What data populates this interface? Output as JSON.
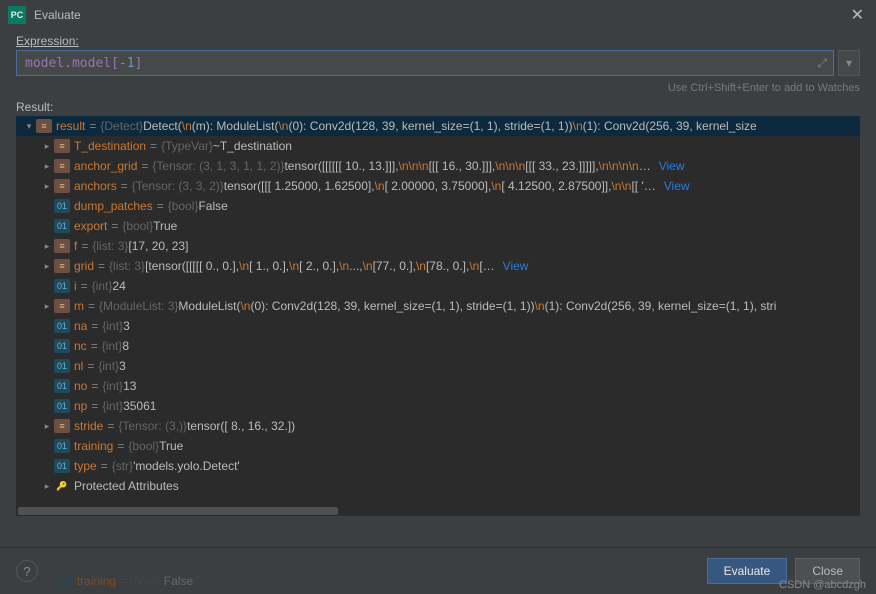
{
  "window": {
    "title": "Evaluate"
  },
  "labels": {
    "expression": "Expression:",
    "result": "Result:",
    "hint": "Use Ctrl+Shift+Enter to add to Watches"
  },
  "expression": {
    "prefix": "model.model[",
    "index": "-1",
    "suffix": "]"
  },
  "buttons": {
    "evaluate": "Evaluate",
    "close": "Close"
  },
  "tree": [
    {
      "depth": 0,
      "arrow": "down",
      "icon": "obj",
      "name": "result",
      "type": "{Detect}",
      "value_parts": [
        " Detect(",
        "\\n",
        "   (m): ModuleList(",
        "\\n",
        "     (0): Conv2d(128, 39, kernel_size=(1, 1), stride=(1, 1))",
        "\\n",
        "     (1): Conv2d(256, 39, kernel_size"
      ],
      "selected": true
    },
    {
      "depth": 1,
      "arrow": "right",
      "icon": "obj",
      "name": "T_destination",
      "type": "{TypeVar}",
      "value": " ~T_destination"
    },
    {
      "depth": 1,
      "arrow": "right",
      "icon": "obj",
      "name": "anchor_grid",
      "type": "{Tensor: (3, 1, 3, 1, 1, 2)}",
      "value_parts": [
        " tensor([[[[[[ 10.,   13.]]],",
        "\\n\\n\\n",
        "          [[[ 16.,   30.]]],",
        "\\n\\n\\n",
        "          [[[ 33.,   23.]]]]],",
        "\\n\\n\\n\\n",
        "…"
      ],
      "view": "View"
    },
    {
      "depth": 1,
      "arrow": "right",
      "icon": "obj",
      "name": "anchors",
      "type": "{Tensor: (3, 3, 2)}",
      "value_parts": [
        " tensor([[[ 1.25000,   1.62500],",
        "\\n",
        "         [ 2.00000,   3.75000],",
        "\\n",
        "         [ 4.12500,   2.87500]],",
        "\\n\\n",
        "        [[ '…"
      ],
      "view": "View"
    },
    {
      "depth": 1,
      "arrow": "none",
      "icon": "bool",
      "name": "dump_patches",
      "type": "{bool}",
      "value": " False"
    },
    {
      "depth": 1,
      "arrow": "none",
      "icon": "bool",
      "name": "export",
      "type": "{bool}",
      "value": " True"
    },
    {
      "depth": 1,
      "arrow": "right",
      "icon": "obj",
      "name": "f",
      "type": "{list: 3}",
      "value": " [17, 20, 23]"
    },
    {
      "depth": 1,
      "arrow": "right",
      "icon": "obj",
      "name": "grid",
      "type": "{list: 3}",
      "value_parts": [
        " [tensor([[[[[ 0.,   0.],",
        "\\n",
        "           [ 1.,   0.],",
        "\\n",
        "           [ 2.,   0.],",
        "\\n",
        "           ...,",
        "\\n",
        "           [77.,   0.],",
        "\\n",
        "           [78.,   0.],",
        "\\n",
        "           […"
      ],
      "view": "View"
    },
    {
      "depth": 1,
      "arrow": "none",
      "icon": "bool",
      "name": "i",
      "type": "{int}",
      "value": " 24"
    },
    {
      "depth": 1,
      "arrow": "right",
      "icon": "obj",
      "name": "m",
      "type": "{ModuleList: 3}",
      "value_parts": [
        " ModuleList(",
        "\\n",
        "   (0): Conv2d(128, 39, kernel_size=(1, 1), stride=(1, 1))",
        "\\n",
        "   (1): Conv2d(256, 39, kernel_size=(1, 1), stri"
      ]
    },
    {
      "depth": 1,
      "arrow": "none",
      "icon": "bool",
      "name": "na",
      "type": "{int}",
      "value": " 3"
    },
    {
      "depth": 1,
      "arrow": "none",
      "icon": "bool",
      "name": "nc",
      "type": "{int}",
      "value": " 8"
    },
    {
      "depth": 1,
      "arrow": "none",
      "icon": "bool",
      "name": "nl",
      "type": "{int}",
      "value": " 3"
    },
    {
      "depth": 1,
      "arrow": "none",
      "icon": "bool",
      "name": "no",
      "type": "{int}",
      "value": " 13"
    },
    {
      "depth": 1,
      "arrow": "none",
      "icon": "bool",
      "name": "np",
      "type": "{int}",
      "value": " 35061"
    },
    {
      "depth": 1,
      "arrow": "right",
      "icon": "obj",
      "name": "stride",
      "type": "{Tensor: (3,)}",
      "value": " tensor([ 8., 16., 32.])"
    },
    {
      "depth": 1,
      "arrow": "none",
      "icon": "bool",
      "name": "training",
      "type": "{bool}",
      "value": " True"
    },
    {
      "depth": 1,
      "arrow": "none",
      "icon": "bool",
      "name": "type",
      "type": "{str}",
      "value": " 'models.yolo.Detect'"
    },
    {
      "depth": 1,
      "arrow": "right",
      "icon": "key",
      "name_plain": "Protected Attributes"
    }
  ],
  "background_row": {
    "name": "training",
    "type": "{bool}",
    "value": " False"
  },
  "watermark": "CSDN @abcdzgh"
}
